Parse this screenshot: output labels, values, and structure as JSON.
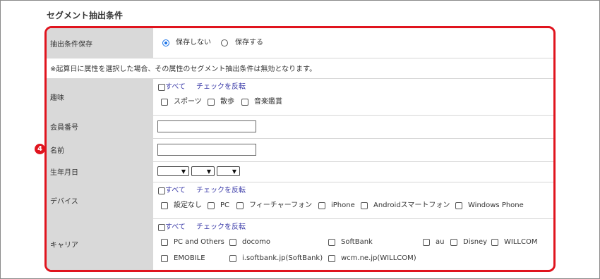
{
  "section_title": "セグメント抽出条件",
  "badge_number": "4",
  "save_condition": {
    "label": "抽出条件保存",
    "options": [
      "保存しない",
      "保存する"
    ],
    "selected": "保存しない"
  },
  "note": "※起算日に属性を選択した場合、その属性のセグメント抽出条件は無効となります。",
  "common": {
    "select_all": "すべて",
    "invert": "チェックを反転"
  },
  "hobby": {
    "label": "趣味",
    "options": [
      "スポーツ",
      "散歩",
      "音楽鑑賞"
    ]
  },
  "member_no": {
    "label": "会員番号",
    "value": ""
  },
  "name": {
    "label": "名前",
    "value": ""
  },
  "birth": {
    "label": "生年月日"
  },
  "device": {
    "label": "デバイス",
    "options": [
      "設定なし",
      "PC",
      "フィーチャーフォン",
      "iPhone",
      "Androidスマートフォン",
      "Windows Phone"
    ]
  },
  "carrier": {
    "label": "キャリア",
    "options": [
      "PC and Others",
      "docomo",
      "SoftBank",
      "au",
      "Disney",
      "WILLCOM",
      "EMOBILE",
      "i.softbank.jp(SoftBank)",
      "wcm.ne.jp(WILLCOM)"
    ]
  }
}
